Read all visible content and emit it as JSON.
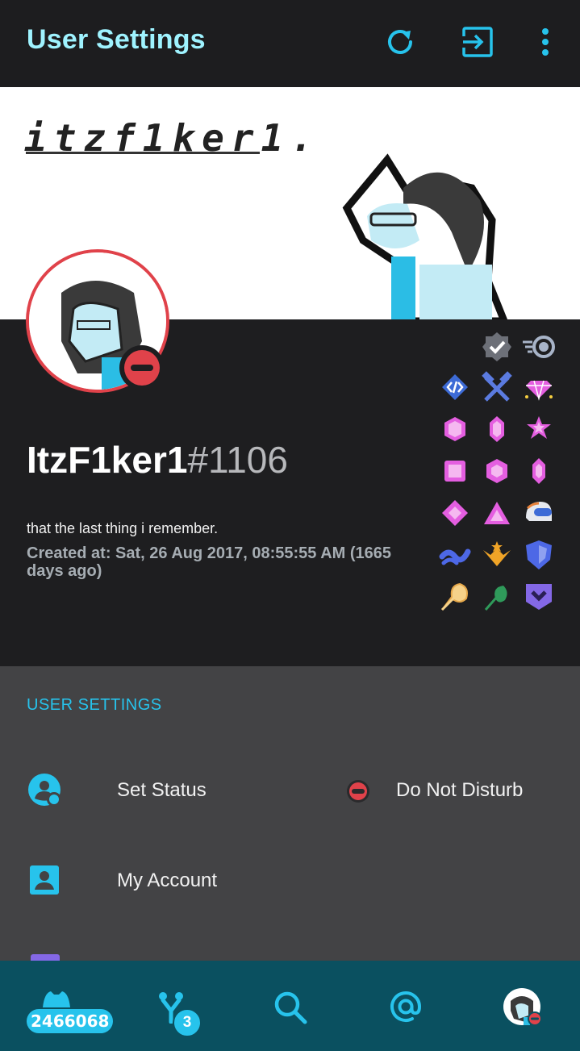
{
  "appbar": {
    "title": "User Settings",
    "icons": [
      "refresh-icon",
      "logout-icon",
      "more-vert-icon"
    ]
  },
  "banner": {
    "text": "itzf1ker1."
  },
  "profile": {
    "username": "ItzF1ker1",
    "discriminator": "#1106",
    "about": "that the last thing i remember.",
    "created": "Created at: Sat, 26 Aug 2017, 08:55:55 AM (1665 days ago)",
    "status_color": "#e0424a"
  },
  "badges": [
    "verified-badge-icon",
    "nitro-badge-icon",
    "dev-badge-icon",
    "hammer-badge-icon",
    "gem-badge-icon",
    "boost-1-badge-icon",
    "boost-2-badge-icon",
    "boost-star-badge-icon",
    "boost-3-badge-icon",
    "boost-4-badge-icon",
    "boost-5-badge-icon",
    "boost-6-badge-icon",
    "boost-7-badge-icon",
    "helmet-badge-icon",
    "hypesquad-balance-badge-icon",
    "hypesquad-bravery-badge-icon",
    "shield-badge-icon",
    "bug-hunter-badge-icon",
    "leaf-badge-icon",
    "chevron-badge-icon"
  ],
  "settings": {
    "header": "USER SETTINGS",
    "items": [
      {
        "label": "Set Status",
        "value": "Do Not Disturb",
        "icon": "status-user-icon"
      },
      {
        "label": "My Account",
        "icon": "account-icon"
      }
    ]
  },
  "bottomnav": {
    "server_count": "2466068",
    "friends_count": "3",
    "icons": [
      "guilds-icon",
      "friends-icon",
      "search-icon",
      "mentions-icon",
      "profile-avatar-icon"
    ]
  },
  "colors": {
    "accent": "#27c3ec",
    "title": "#9ff3ff",
    "dnd": "#e0424a",
    "nav_bg": "#0a5060"
  }
}
